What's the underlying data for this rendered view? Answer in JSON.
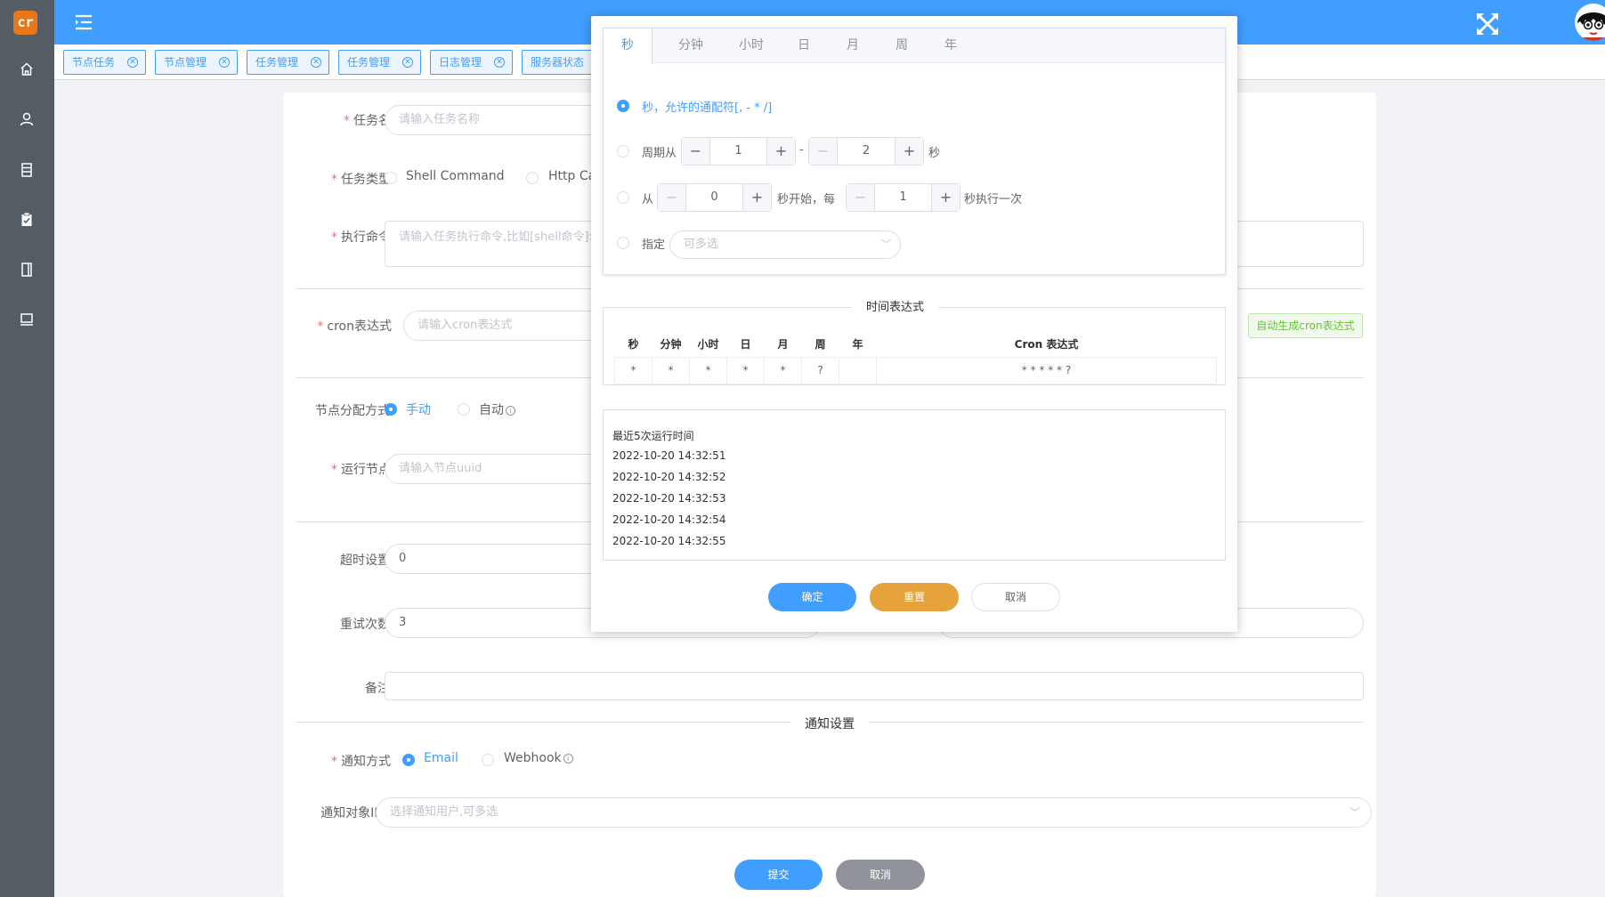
{
  "app": {
    "logo_text": "cr"
  },
  "sidebar": {
    "icons": [
      "home-icon",
      "user-icon",
      "list-icon",
      "clipboard-icon",
      "book-icon",
      "monitor-icon"
    ]
  },
  "tags": [
    {
      "label": "节点任务"
    },
    {
      "label": "节点管理"
    },
    {
      "label": "任务管理"
    },
    {
      "label": "任务管理"
    },
    {
      "label": "日志管理"
    },
    {
      "label": "服务器状态"
    }
  ],
  "form": {
    "task_name": {
      "label": "任务名",
      "placeholder": "请输入任务名称"
    },
    "task_type": {
      "label": "任务类型",
      "options": [
        "Shell Command",
        "Http Ca"
      ]
    },
    "command": {
      "label": "执行命令",
      "placeholder": "请输入任务执行命令,比如[shell命令]:"
    },
    "cron": {
      "label": "cron表达式",
      "placeholder": "请输入cron表达式",
      "gen_button": "自动生成cron表达式"
    },
    "node_assign": {
      "label": "节点分配方式",
      "options": [
        "手动",
        "自动"
      ]
    },
    "run_node": {
      "label": "运行节点",
      "placeholder": "请输入节点uuid"
    },
    "timeout": {
      "label": "超时设置",
      "value": "0"
    },
    "retry": {
      "label": "重试次数",
      "value": "3"
    },
    "remark": {
      "label": "备注"
    },
    "notify_section": "通知设置",
    "notify_method": {
      "label": "通知方式",
      "options": [
        "Email",
        "Webhook"
      ]
    },
    "notify_target": {
      "label": "通知对象ID",
      "placeholder": "选择通知用户,可多选"
    },
    "submit": "提交",
    "cancel": "取消"
  },
  "dialog": {
    "tabs": [
      "秒",
      "分钟",
      "小时",
      "日",
      "月",
      "周",
      "年"
    ],
    "opt_wildcard": "秒，允许的通配符[, - * /]",
    "opt_period": {
      "prefix": "周期从",
      "from": "1",
      "dash": "-",
      "to": "2",
      "suffix": "秒"
    },
    "opt_from": {
      "prefix": "从",
      "start": "0",
      "mid": "秒开始，每",
      "step": "1",
      "suffix": "秒执行一次"
    },
    "opt_specify": {
      "prefix": "指定",
      "placeholder": "可多选"
    },
    "expr_title": "时间表达式",
    "table_headers": [
      "秒",
      "分钟",
      "小时",
      "日",
      "月",
      "周",
      "年",
      "Cron 表达式"
    ],
    "table_values": [
      "*",
      "*",
      "*",
      "*",
      "*",
      "?",
      "",
      "* * * * * ?"
    ],
    "run_title": "最近5次运行时间",
    "run_times": [
      "2022-10-20 14:32:51",
      "2022-10-20 14:32:52",
      "2022-10-20 14:32:53",
      "2022-10-20 14:32:54",
      "2022-10-20 14:32:55"
    ],
    "btn_ok": "确定",
    "btn_reset": "重置",
    "btn_cancel": "取消"
  },
  "colors": {
    "primary": "#409eff",
    "sidebar": "#545c64",
    "warning": "#e6a23c",
    "danger": "#f56c6c",
    "info": "#909399",
    "success": "#67c23a"
  }
}
